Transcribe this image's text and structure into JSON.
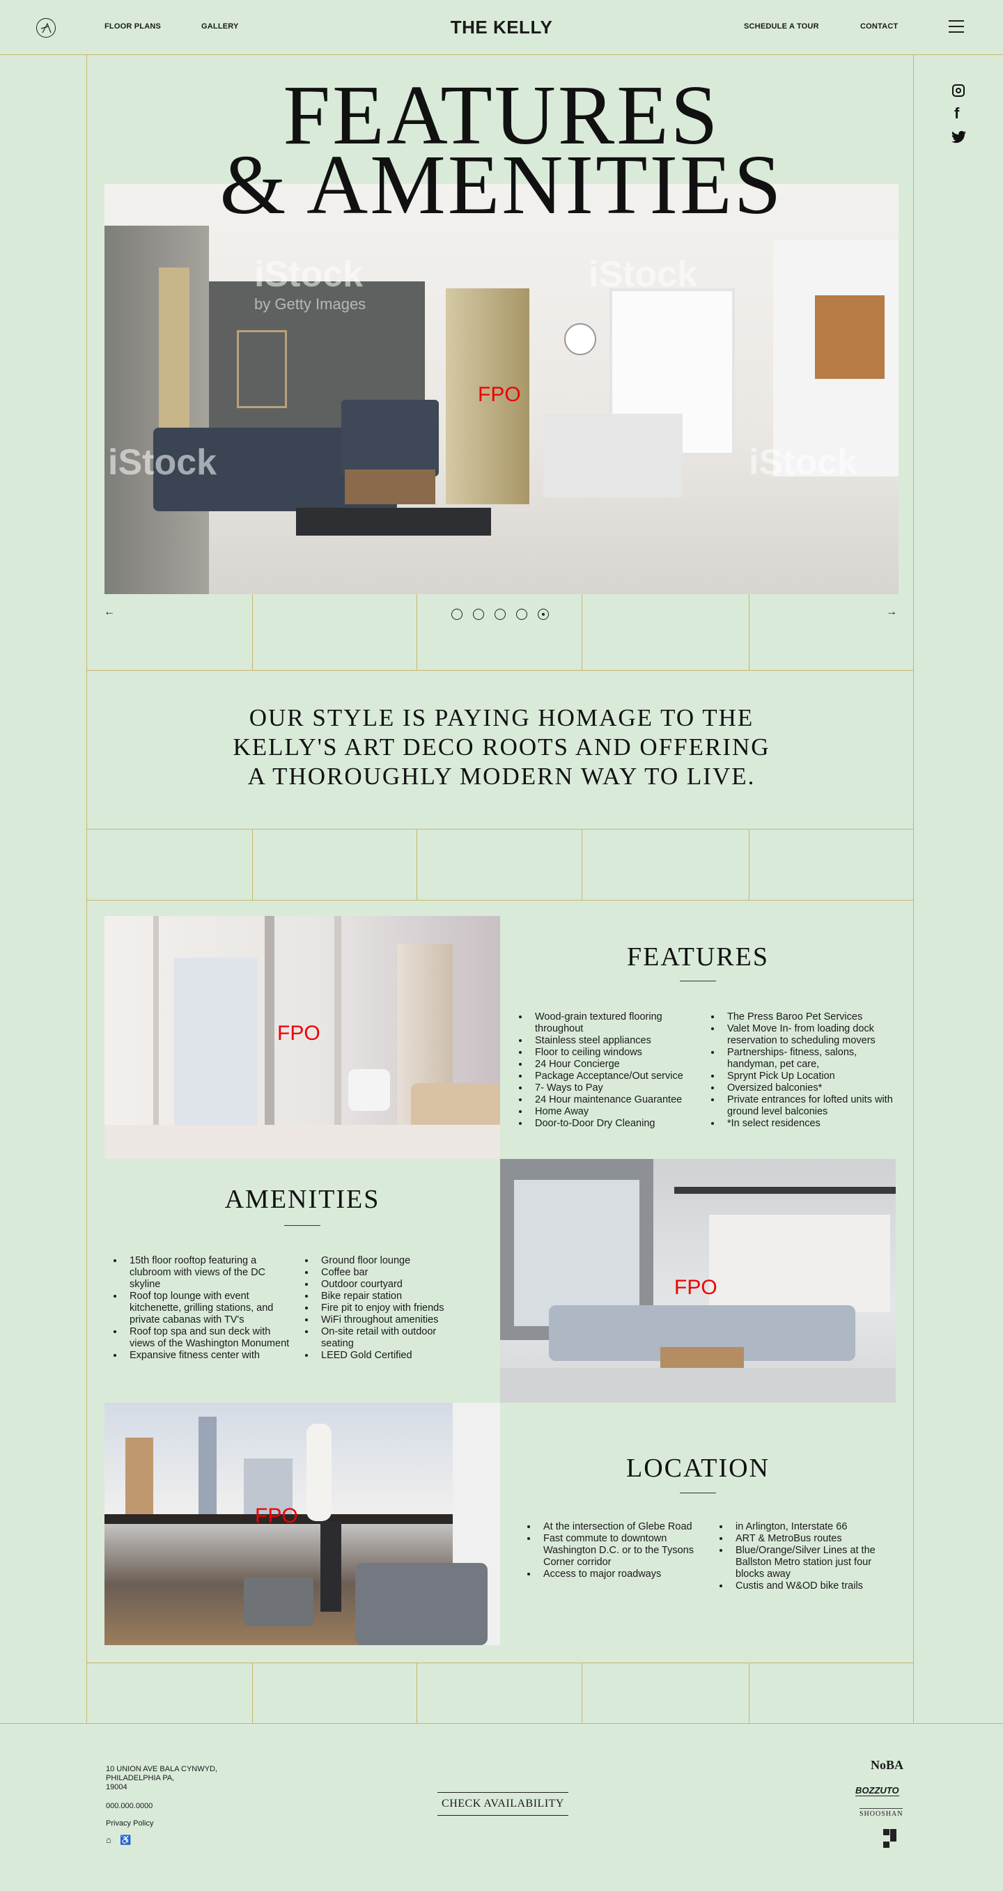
{
  "header": {
    "brand": "THE KELLY",
    "nav_left": [
      "FLOOR PLANS",
      "GALLERY"
    ],
    "nav_right": [
      "SCHEDULE A TOUR",
      "CONTACT"
    ]
  },
  "hero": {
    "title_line1": "FEATURES",
    "title_line2": "& AMENITIES",
    "fpo": "FPO",
    "watermark": "iStock",
    "watermark_sub": "by Getty Images",
    "slide_count": 5
  },
  "quote": {
    "line1": "OUR STYLE IS PAYING HOMAGE TO THE",
    "line2": "KELLY'S ART DECO ROOTS AND OFFERING",
    "line3": "A THOROUGHLY MODERN WAY TO LIVE."
  },
  "features": {
    "title": "FEATURES",
    "fpo": "FPO",
    "col1": [
      "Wood-grain textured flooring throughout",
      "Stainless steel appliances",
      "Floor to ceiling windows",
      "24 Hour Concierge",
      "Package Acceptance/Out service",
      "7- Ways to Pay",
      "24 Hour maintenance Guarantee",
      "Home Away",
      "Door-to-Door Dry Cleaning"
    ],
    "col2": [
      "The Press Baroo Pet Services",
      "Valet Move In- from loading dock reservation to scheduling movers",
      "Partnerships- fitness, salons, handyman, pet care,",
      "Sprynt Pick Up Location",
      "Oversized balconies*",
      "Private entrances for lofted units with ground level balconies",
      "*In select residences"
    ]
  },
  "amenities": {
    "title": "AMENITIES",
    "fpo": "FPO",
    "col1": [
      "15th floor rooftop featuring a clubroom with views of the DC skyline",
      "Roof top lounge with event kitchenette, grilling stations, and private cabanas with TV's",
      "Roof top spa and sun deck with views of the Washington Monument",
      "Expansive fitness center with"
    ],
    "col2": [
      "Ground floor lounge",
      "Coffee bar",
      "Outdoor courtyard",
      "Bike repair station",
      "Fire pit to enjoy with friends",
      "WiFi throughout amenities",
      "On-site retail with outdoor seating",
      "LEED Gold Certified"
    ]
  },
  "location": {
    "title": "LOCATION",
    "fpo": "FPO",
    "col1": [
      "At the intersection of Glebe Road",
      "Fast commute to downtown Washington D.C. or to the Tysons Corner corridor",
      "Access to major roadways"
    ],
    "col2": [
      "in Arlington, Interstate 66",
      "ART & MetroBus routes",
      "Blue/Orange/Silver Lines at the Ballston Metro station just four blocks away",
      "Custis and W&OD bike trails"
    ]
  },
  "footer": {
    "address1": "10 UNION AVE BALA CYNWYD,",
    "address2": "PHILADELPHIA PA,",
    "address3": "19004",
    "phone": "000.000.0000",
    "privacy": "Privacy Policy",
    "cta": "CHECK AVAILABILITY",
    "logo1": "NoBA",
    "logo2": "BOZZUTO",
    "logo3": "SHOOSHAN"
  }
}
